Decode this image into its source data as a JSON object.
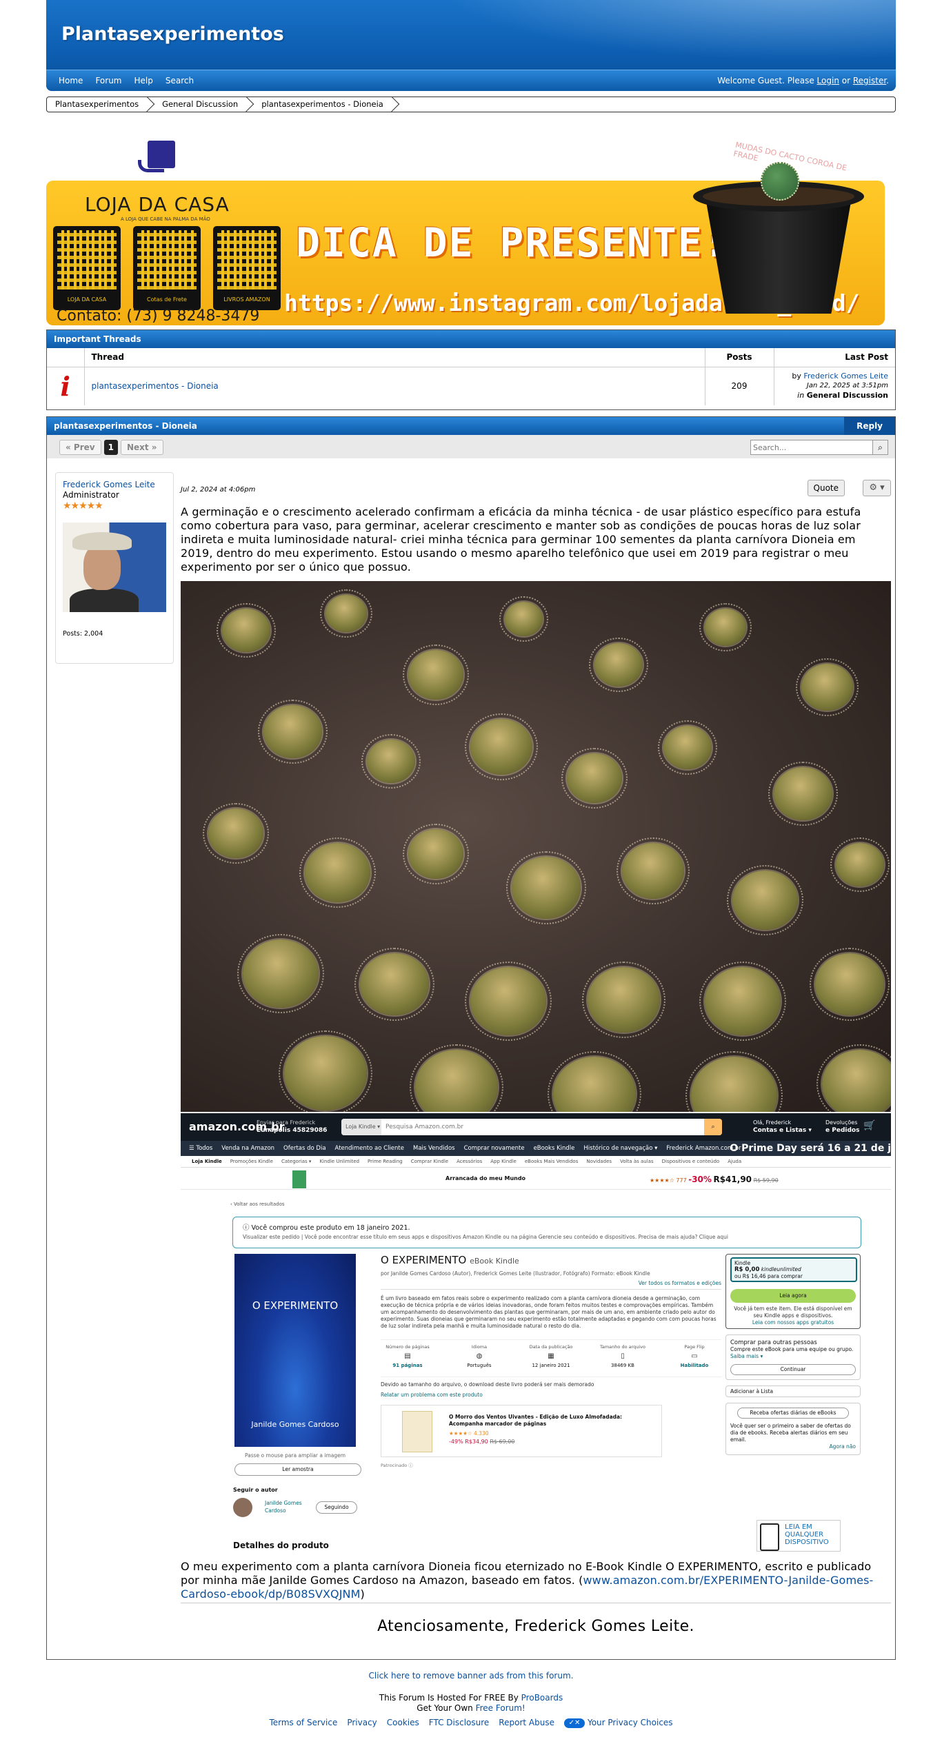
{
  "site": {
    "title": "Plantasexperimentos",
    "nav": [
      "Home",
      "Forum",
      "Help",
      "Search"
    ],
    "welcome_prefix": "Welcome Guest. Please",
    "login": "Login",
    "or": "or",
    "register": "Register",
    "register_suffix": "."
  },
  "breadcrumb": [
    "Plantasexperimentos",
    "General Discussion",
    "plantasexperimentos - Dioneia"
  ],
  "banner": {
    "shop_name": "LOJA DA CASA",
    "shop_tagline": "A LOJA QUE CABE NA PALMA DA MÃO",
    "qr_labels": [
      "LOJA DA CASA",
      "Cotas de Frete",
      "LIVROS AMAZON"
    ],
    "contact": "Contato: (73) 9 8248-3479",
    "headline": "DICA DE PRESENTE:",
    "instagram": "https://www.instagram.com/lojadacasa_fred/",
    "pot_caption": "MUDAS DO CACTO COROA DE FRADE"
  },
  "important": {
    "title": "Important Threads",
    "columns": [
      "Thread",
      "Posts",
      "Last Post"
    ],
    "row": {
      "icon": "i",
      "thread": "plantasexperimentos - Dioneia",
      "posts": "209",
      "by": "by",
      "author": "Frederick Gomes Leite",
      "date": "Jan 22, 2025 at 3:51pm",
      "in": "in",
      "board": "General Discussion"
    }
  },
  "thread": {
    "title": "plantasexperimentos - Dioneia",
    "reply": "Reply",
    "prev": "« Prev",
    "page": "1",
    "next": "Next »",
    "search_placeholder": "Search..."
  },
  "user": {
    "name": "Frederick Gomes Leite",
    "role": "Administrator",
    "stars": "★★★★★",
    "posts": "Posts: 2,004"
  },
  "post": {
    "date": "Jul 2, 2024 at 4:06pm",
    "quote": "Quote",
    "text1": "A germinação e o crescimento acelerado confirmam a eficácia da minha técnica - de usar plástico específico para estufa como cobertura para vaso, para germinar, acelerar crescimento e manter sob as condições de poucas horas de luz solar indireta e muita luminosidade natural- criei minha técnica para germinar 100 sementes da planta carnívora Dioneia em 2019, dentro do meu experimento. Estou usando o mesmo aparelho telefônico que usei em 2019 para registrar o meu experimento por ser o único que possuo.",
    "text2_before": "O meu experimento com a planta carnívora Dioneia ficou eternizado no E-Book Kindle O EXPERIMENTO, escrito e publicado por minha mãe Janilde Gomes Cardoso na Amazon, baseado em fatos. (",
    "text2_link": "www.amazon.com.br/EXPERIMENTO-Janilde-Gomes-Cardoso-ebook/dp/B08SVXQJNM",
    "text2_after": ")",
    "signature": "Atenciosamente, Frederick Gomes Leite."
  },
  "amazon": {
    "logo": "amazon.com.br",
    "deliver_line1": "Enviar para Frederick",
    "deliver_line2": "Eunápolis 45829086",
    "search_cat": "Loja Kindle ▾",
    "search_q": "Pesquisa Amazon.com.br",
    "account_line1": "Olá, Frederick",
    "account_line2": "Contas e Listas ▾",
    "returns_line1": "Devoluções",
    "returns_line2": "e Pedidos",
    "nav": [
      "☰ Todos",
      "Venda na Amazon",
      "Ofertas do Dia",
      "Atendimento ao Cliente",
      "Mais Vendidos",
      "Comprar novamente",
      "eBooks Kindle",
      "Histórico de navegação ▾",
      "Frederick Amazon.com.br"
    ],
    "prime": "O Prime Day será 16 a 21 de j",
    "subnav": [
      "Loja Kindle",
      "Promoções Kindle",
      "Categorias ▾",
      "Kindle Unlimited",
      "Prime Reading",
      "Comprar Kindle",
      "Acessórios",
      "App Kindle",
      "eBooks Mais Vendidos",
      "Novidades",
      "Volta às aulas",
      "Dispositivos e conteúdo",
      "Ajuda"
    ],
    "strip_title": "Arrancada do meu Mundo",
    "strip_rating": "★★★★☆ 777",
    "strip_discount": "-30%",
    "strip_price": "R$41,90",
    "strip_old": "R$ 59,90",
    "back": "‹ Voltar aos resultados",
    "notice": "Você comprou este produto em 18 janeiro 2021.",
    "notice_sub": "Visualizar este pedido | Você pode encontrar esse título em seus apps e dispositivos Amazon Kindle ou na página Gerencie seu conteúdo e dispositivos. Precisa de mais ajuda? Clique aqui",
    "cover_title": "O EXPERIMENTO",
    "cover_author": "Janilde Gomes Cardoso",
    "zoom": "Passe o mouse para ampliar a imagem",
    "sample": "Ler amostra",
    "follow": "Seguir o autor",
    "author": "Janilde Gomes Cardoso",
    "seguir": "Seguindo",
    "details": "Detalhes do produto",
    "title": "O EXPERIMENTO",
    "title_fmt": "eBook Kindle",
    "byline": "por Janilde Gomes Cardoso (Autor), Frederick Gomes Leite (Ilustrador, Fotógrafo)   Formato: eBook Kindle",
    "formats": "Ver todos os formatos e edições",
    "desc": "É um livro baseado em fatos reais sobre o experimento realizado com a planta carnívora dioneia desde a germinação, com execução de técnica própria e de vários ideias inovadoras, onde foram feitos muitos testes e comprovações empíricas. Também um acompanhamento do desenvolvimento das plantas que germinaram, por mais de um ano, em ambiente criado pelo autor do experimento. Suas dioneias que germinaram no seu experimento estão totalmente adaptadas e pegando com com poucas horas de luz solar indireta pela manhã e muita luminosidade natural o resto do dia.",
    "specs": [
      {
        "label": "Número de páginas",
        "icon": "▤",
        "value": "91 páginas"
      },
      {
        "label": "Idioma",
        "icon": "◍",
        "value": "Português"
      },
      {
        "label": "Data da publicação",
        "icon": "▦",
        "value": "12 janeiro 2021"
      },
      {
        "label": "Tamanho do arquivo",
        "icon": "▯",
        "value": "38469 KB"
      },
      {
        "label": "Page Flip",
        "icon": "▭",
        "value": "Habilitado"
      }
    ],
    "download_note": "Devido ao tamanho do arquivo, o download deste livro poderá ser mais demorado",
    "report": "Relatar um problema com este produto",
    "ad_title": "O Morro dos Ventos Uivantes - Edição de Luxo Almofadada: Acompanha marcador de páginas",
    "ad_stars": "★★★★☆ 4.330",
    "ad_price": "-49% R$34,90",
    "ad_old": "R$ 69,00",
    "sponsored": "Patrocinado ⓘ",
    "kindle_label": "Kindle",
    "kindle_price": "R$ 0,00",
    "kindle_unlimited": "kindleunlimited",
    "kindle_buy": "ou R$ 16,46 para comprar",
    "read_now": "Leia agora",
    "owned_note": "Você já tem este item. Ele está disponível em seu Kindle apps e dispositivos.",
    "free_apps": "Leia com nossos apps gratuitos",
    "others_title": "Comprar para outras pessoas",
    "others_desc": "Compre este eBook para uma equipe ou grupo.",
    "more": "Saiba mais ▾",
    "continue": "Continuar",
    "add_list": "Adicionar à Lista",
    "alerts_btn": "Receba ofertas diárias de eBooks",
    "alerts_desc": "Você quer ser o primeiro a saber de ofertas do dia de ebooks. Receba alertas diários em seu email.",
    "alerts_no": "Agora não",
    "device_text": "LEIA EM QUALQUER DISPOSITIVO"
  },
  "footer": {
    "remove_ads": "Click here to remove banner ads from this forum.",
    "hosted": "This Forum Is Hosted For FREE By",
    "proboards": "ProBoards",
    "own": "Get Your Own",
    "free_forum": "Free Forum!",
    "links": [
      "Terms of Service",
      "Privacy",
      "Cookies",
      "FTC Disclosure",
      "Report Abuse"
    ],
    "privacy_choices": "Your Privacy Choices"
  }
}
